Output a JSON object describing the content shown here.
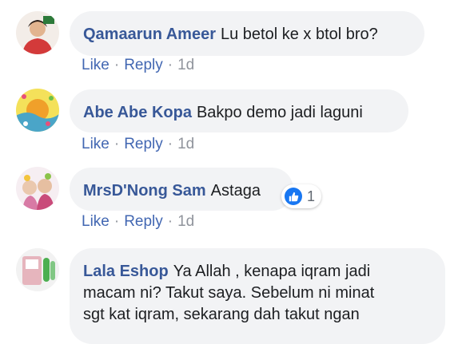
{
  "comments": [
    {
      "author": "Qamaarun Ameer",
      "text": "Lu betol ke x btol bro?",
      "actions": {
        "like": "Like",
        "reply": "Reply",
        "time": "1d"
      }
    },
    {
      "author": "Abe Abe Kopa",
      "text": "Bakpo demo jadi laguni",
      "actions": {
        "like": "Like",
        "reply": "Reply",
        "time": "1d"
      }
    },
    {
      "author": "MrsD'Nong Sam",
      "text": "Astaga",
      "actions": {
        "like": "Like",
        "reply": "Reply",
        "time": "1d"
      },
      "reaction": {
        "icon": "like-icon",
        "count": "1"
      }
    },
    {
      "author": "Lala Eshop",
      "text_lines": [
        "Ya Allah , kenapa iqram jadi",
        "macam ni? Takut saya. Sebelum ni minat",
        "sgt kat iqram, sekarang dah takut ngan"
      ]
    }
  ],
  "separator": "·",
  "colors": {
    "author": "#385898",
    "link": "#4267b2",
    "muted": "#90949c",
    "bubble": "#f2f3f5",
    "like": "#1877f2"
  }
}
